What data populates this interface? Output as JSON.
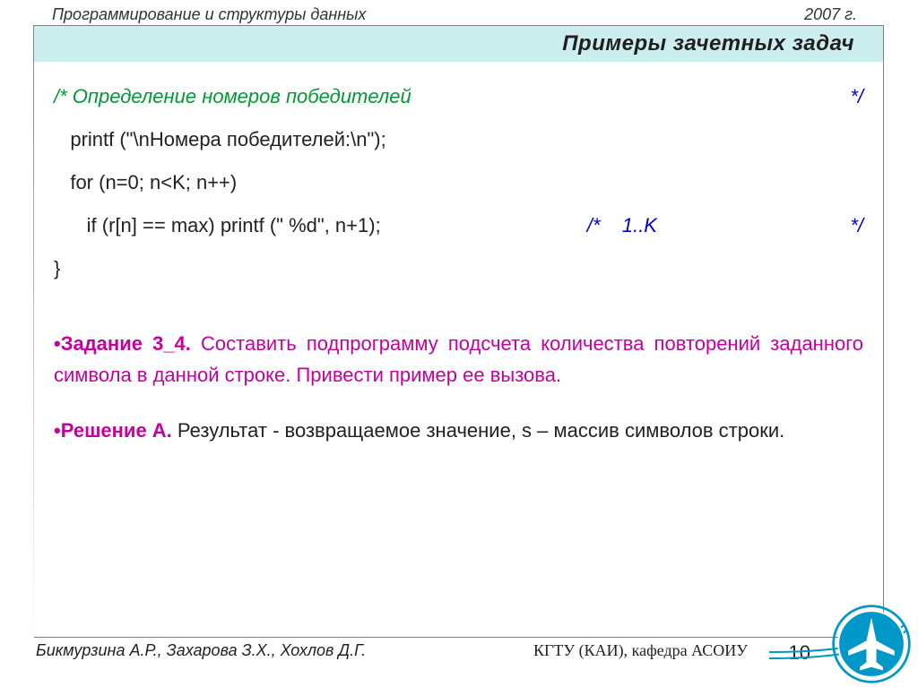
{
  "header": {
    "title": "Программирование  и структуры данных",
    "year": "2007 г."
  },
  "slide": {
    "title": "Примеры зачетных задач",
    "code": {
      "comment_open": "/* Определение номеров победителей",
      "comment_close": "*/",
      "l1": "   printf (\"\\nНомера победителей:\\n\");",
      "l2": "   for (n=0; n<K; n++)",
      "l3_left": "      if (r[n] == max) printf (\" %d\", n+1);",
      "l3_mid": "/*    1..K",
      "l3_right": "*/",
      "l4": "}"
    },
    "task": {
      "bullet": "•",
      "title": "Задание 3_4.",
      "text": " Составить подпрограмму подсчета количества повторений заданного символа в данной строке. Привести пример ее вызова."
    },
    "solution": {
      "bullet": "•",
      "title": "Решение А.",
      "text": " Результат - возвращаемое значение, s – массив символов строки."
    }
  },
  "footer": {
    "authors": "Бикмурзина А.Р., Захарова З.Х., Хохлов Д.Г.",
    "org": "КГТУ  (КАИ),   кафедра АСОИУ",
    "page": "10"
  }
}
